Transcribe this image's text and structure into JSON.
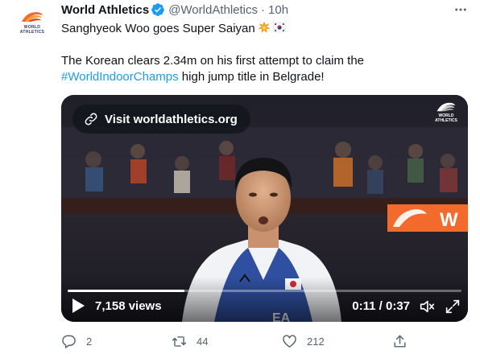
{
  "author": {
    "display_name": "World Athletics",
    "handle": "@WorldAthletics",
    "separator": "·",
    "time": "10h",
    "avatar_text": "WORLD\nATHLETICS"
  },
  "tweet": {
    "line1": "Sanghyeok Woo goes Super Saiyan",
    "line2": "The Korean clears 2.34m on his first attempt to claim the",
    "hashtag": "#WorldIndoorChamps",
    "line3_rest": " high jump title in Belgrade!",
    "emojis": [
      "collision-emoji",
      "south-korea-flag-emoji"
    ]
  },
  "video": {
    "visit_label": "Visit worldathletics.org",
    "watermark_text": "WORLD\nATHLETICS",
    "banner_text": "W",
    "jersey_text": "EA",
    "views": "7,158 views",
    "timecode": "0:11 / 0:37",
    "progress": 0.2973
  },
  "actions": {
    "replies": "2",
    "retweets": "44",
    "likes": "212"
  },
  "colors": {
    "accent": "#1d9bf0",
    "brand_orange": "#f26b2c",
    "muted": "#536471"
  }
}
